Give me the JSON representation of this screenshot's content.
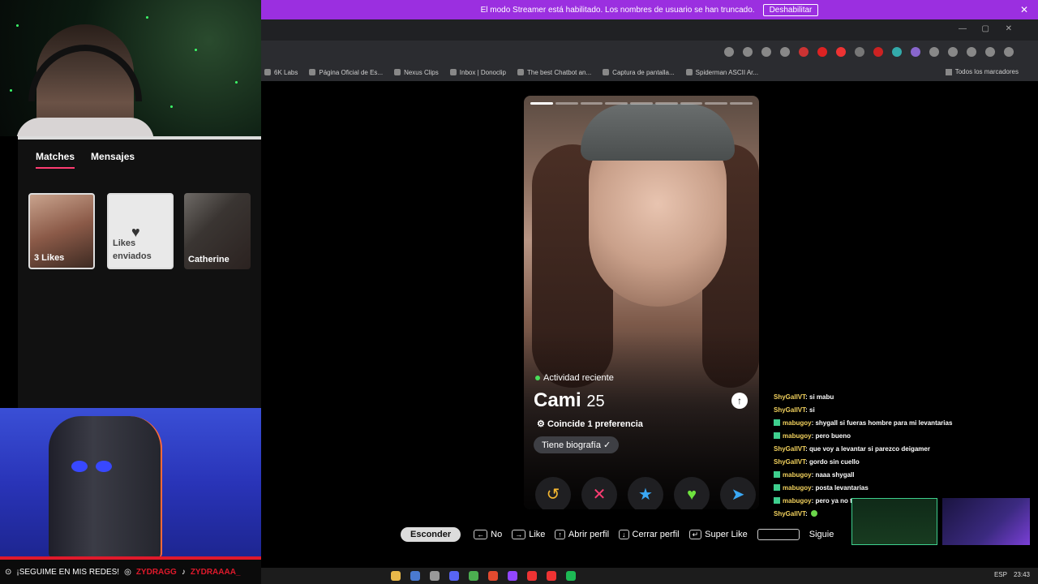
{
  "streamer_bar": {
    "message": "El modo Streamer está habilitado. Los nombres de usuario se han truncado.",
    "button": "Deshabilitar",
    "close": "✕"
  },
  "window_controls": {
    "minimize": "—",
    "maximize": "▢",
    "close": "✕"
  },
  "bookmarks": {
    "items": [
      "6K Labs",
      "Página Oficial de Es...",
      "Nexus Clips",
      "Inbox | Donoclip",
      "The best Chatbot an...",
      "Captura de pantalla...",
      "Spiderman ASCII Ar..."
    ],
    "all": "Todos los marcadores"
  },
  "sidebar": {
    "tabs": [
      "Matches",
      "Mensajes"
    ],
    "cards": [
      "3 Likes",
      "Likes enviados",
      "Catherine"
    ]
  },
  "profile": {
    "activity": "Actividad reciente",
    "name": "Cami",
    "age": "25",
    "match": "Coincide 1 preferencia",
    "bio": "Tiene biografía ✓",
    "photo_index": 1,
    "photo_count": 9
  },
  "actions": {
    "rewind": "↺",
    "nope": "✕",
    "superlike": "★",
    "like": "♥",
    "boost": "➤"
  },
  "hints": {
    "escape": "Esconder",
    "no": "No",
    "like": "Like",
    "open": "Abrir perfil",
    "close": "Cerrar perfil",
    "superlike": "Super Like",
    "next": "Siguie"
  },
  "chat": [
    {
      "user": "ShyGallVT",
      "text": ": si mabu",
      "badge": false
    },
    {
      "user": "ShyGallVT",
      "text": ": si",
      "badge": false
    },
    {
      "user": "mabugoy",
      "text": ": shygall si fueras hombre para mi levantarias",
      "badge": true
    },
    {
      "user": "mabugoy",
      "text": ": pero bueno",
      "badge": true
    },
    {
      "user": "ShyGallVT",
      "text": ": que voy a levantar si parezco deigamer",
      "badge": false
    },
    {
      "user": "ShyGallVT",
      "text": ": gordo sin cuello",
      "badge": false
    },
    {
      "user": "mabugoy",
      "text": ": naaa shygall",
      "badge": true
    },
    {
      "user": "mabugoy",
      "text": ": posta levantarias",
      "badge": true
    },
    {
      "user": "mabugoy",
      "text": ": pero ya no te puedo hacer desgay",
      "badge": true
    },
    {
      "user": "ShyGallVT",
      "text": ":",
      "badge": false
    }
  ],
  "social": {
    "follow": "¡SEGUIME EN MIS REDES!",
    "instagram": "ZYDRAGG",
    "tiktok": "ZYDRAAAA_"
  },
  "taskbar": {
    "lang": "ESP",
    "time": "23:43"
  },
  "colors": {
    "streamer": "#9b2fe0",
    "accent": "#fe3c72",
    "chat_user": "#f4d35e"
  }
}
